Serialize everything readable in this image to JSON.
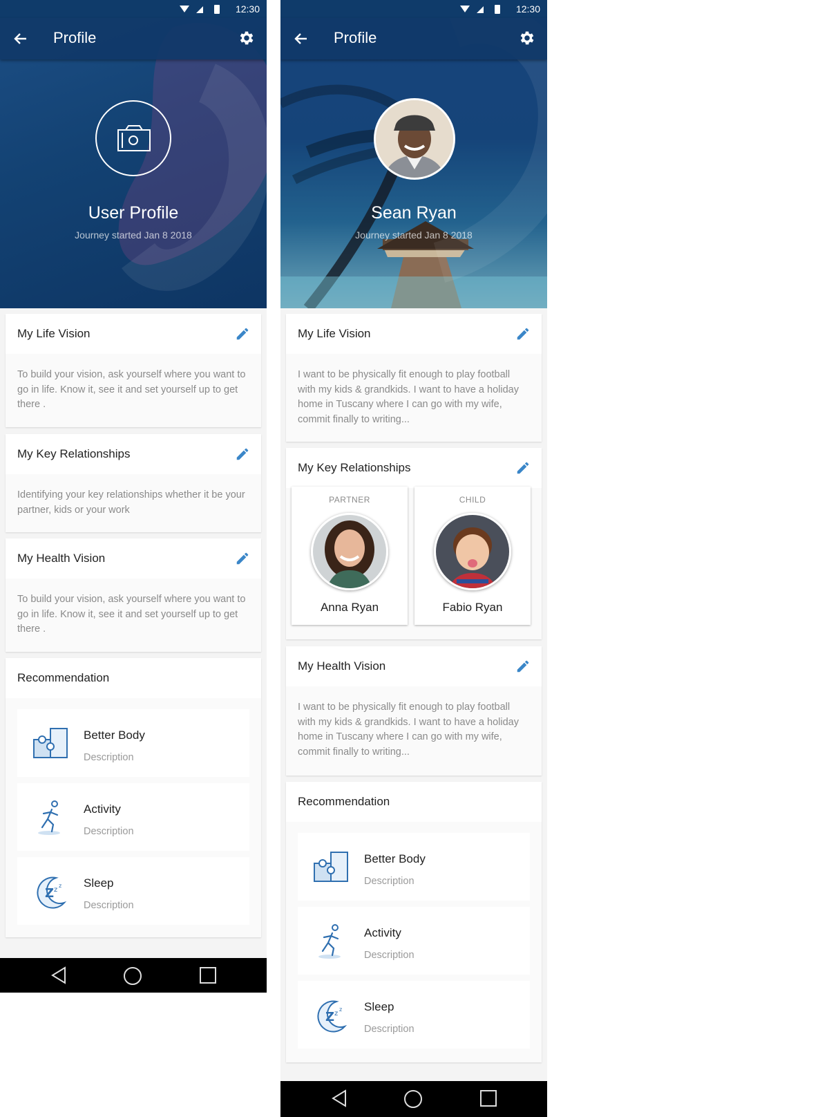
{
  "status_bar": {
    "time": "12:30"
  },
  "screens": [
    {
      "appbar": {
        "title": "Profile"
      },
      "hero": {
        "name": "User Profile",
        "subtitle": "Journey started Jan 8 2018"
      },
      "life_vision": {
        "title": "My Life Vision",
        "text": "To build your vision, ask yourself where you want to go in life. Know it, see it and set yourself up to get there ."
      },
      "key_relationships": {
        "title": "My Key Relationships",
        "text": "Identifying your key relationships whether it be your partner, kids or your work"
      },
      "health_vision": {
        "title": "My Health Vision",
        "text": "To build your vision, ask yourself where you want to go in life. Know it, see it and set yourself up to get there ."
      },
      "recommendation": {
        "title": "Recommendation",
        "items": [
          {
            "title": "Better Body",
            "description": "Description",
            "icon": "puzzle-icon"
          },
          {
            "title": "Activity",
            "description": "Description",
            "icon": "running-person-icon"
          },
          {
            "title": "Sleep",
            "description": "Description",
            "icon": "sleep-moon-icon"
          }
        ]
      }
    },
    {
      "appbar": {
        "title": "Profile"
      },
      "hero": {
        "name": "Sean Ryan",
        "subtitle": "Journey started Jan 8 2018"
      },
      "life_vision": {
        "title": "My Life Vision",
        "text": "I want to be physically fit enough to play football with my kids & grandkids. I want to have a holiday home in Tuscany where I can go with my wife, commit finally to writing..."
      },
      "key_relationships": {
        "title": "My Key Relationships",
        "people": [
          {
            "role": "PARTNER",
            "name": "Anna Ryan"
          },
          {
            "role": "CHILD",
            "name": "Fabio Ryan"
          }
        ]
      },
      "health_vision": {
        "title": "My Health Vision",
        "text": "I want to be physically fit enough to play football with my kids & grandkids. I want to have a holiday home in Tuscany where I can go with my wife, commit finally to writing..."
      },
      "recommendation": {
        "title": "Recommendation",
        "items": [
          {
            "title": "Better Body",
            "description": "Description",
            "icon": "puzzle-icon"
          },
          {
            "title": "Activity",
            "description": "Description",
            "icon": "running-person-icon"
          },
          {
            "title": "Sleep",
            "description": "Description",
            "icon": "sleep-moon-icon"
          }
        ]
      }
    }
  ],
  "colors": {
    "primary": "#134273",
    "accent_icon": "#3a86c8",
    "muted_text": "#8a8a8a"
  }
}
